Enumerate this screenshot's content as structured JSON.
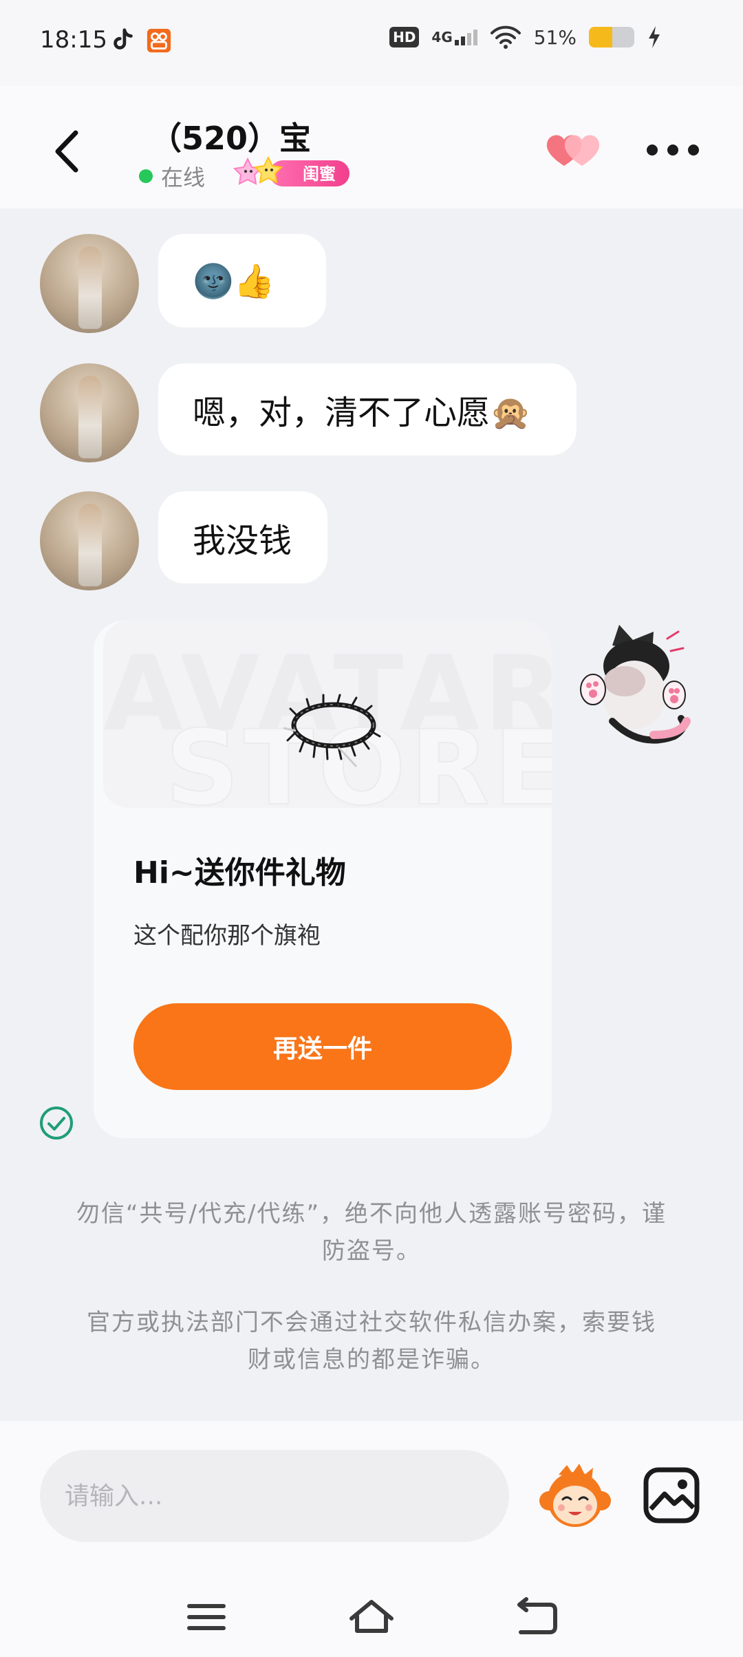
{
  "status_bar": {
    "time": "18:15",
    "hd_label": "HD",
    "network_label": "4G",
    "battery_percent": "51%",
    "battery_level": 0.51,
    "battery_color": "#f5b91b"
  },
  "header": {
    "title": "（520）宝",
    "online_label": "在线",
    "relationship_badge": "闺蜜",
    "online_color": "#26c85a"
  },
  "messages": [
    {
      "from": "contact",
      "text": "🌚👍"
    },
    {
      "from": "contact",
      "text": "嗯，对，清不了心愿🙊"
    },
    {
      "from": "contact",
      "text": "我没钱"
    }
  ],
  "gift_card": {
    "watermark_line1": "AVATAR",
    "watermark_line2": "STORE",
    "title": "Hi~送你件礼物",
    "description": "这个配你那个旗袍",
    "button_label": "再送一件",
    "button_color": "#f97518"
  },
  "notices": [
    {
      "text": "勿信“共号/代充/代练”，绝不向他人透露账号密码，谨防盗号。"
    },
    {
      "text": "官方或执法部门不会通过社交软件私信办案，索要钱财或信息的都是诈骗。"
    }
  ],
  "composer": {
    "placeholder": "请输入..."
  },
  "icons": {
    "back": "chevron-left-icon",
    "hearts": "double-heart-icon",
    "more": "more-dots-icon",
    "sent": "check-circle-icon",
    "emoji": "monkey-emoji-icon",
    "image": "image-icon",
    "nav_menu": "menu-icon",
    "nav_home": "home-icon",
    "nav_back": "return-icon"
  }
}
